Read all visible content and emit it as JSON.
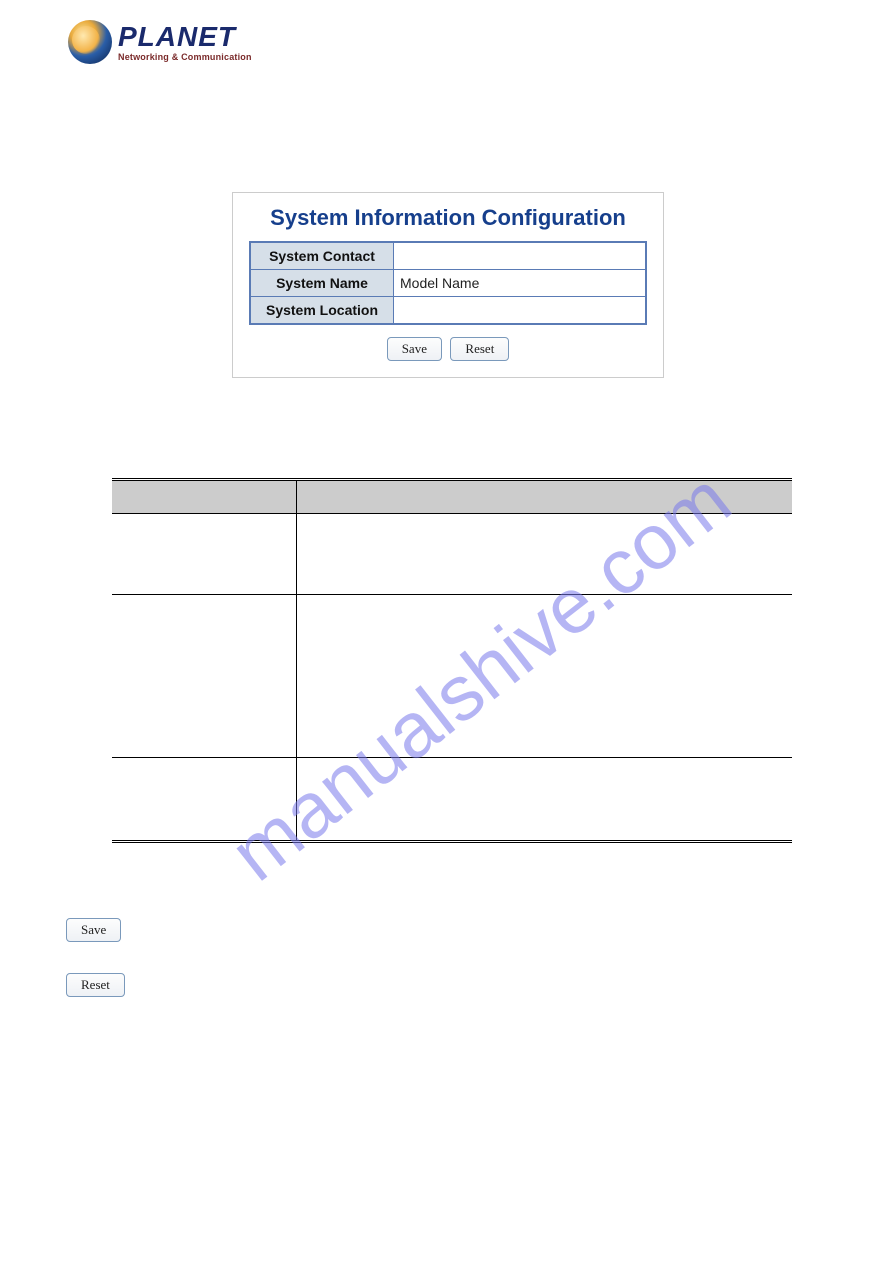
{
  "logo": {
    "main": "PLANET",
    "sub": "Networking & Communication"
  },
  "panel": {
    "title": "System Information Configuration",
    "rows": [
      {
        "label": "System Contact",
        "value": ""
      },
      {
        "label": "System Name",
        "value": "Model Name"
      },
      {
        "label": "System Location",
        "value": ""
      }
    ],
    "save_label": "Save",
    "reset_label": "Reset"
  },
  "standalone": {
    "save_label": "Save",
    "reset_label": "Reset"
  },
  "watermark": "manualshive.com"
}
